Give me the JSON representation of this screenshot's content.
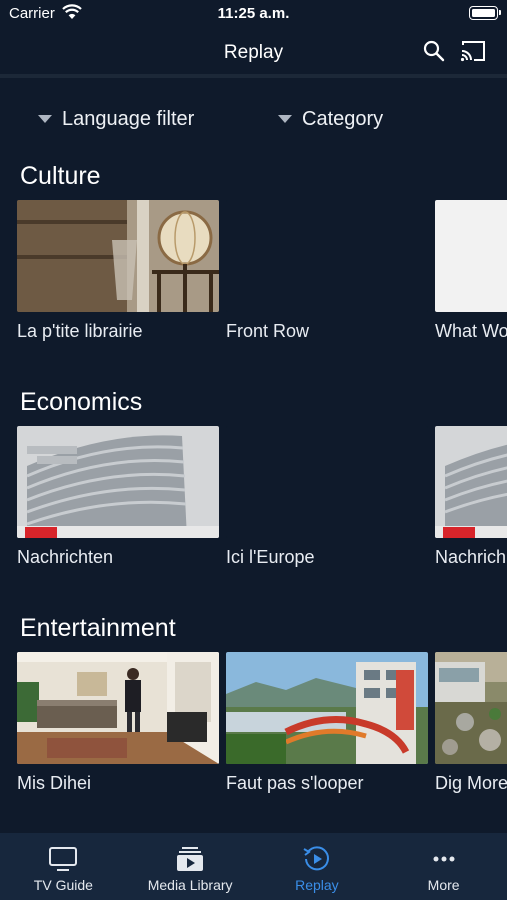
{
  "status_bar": {
    "carrier": "Carrier",
    "time": "11:25 a.m."
  },
  "nav": {
    "title": "Replay",
    "search_icon": "search-icon",
    "cast_icon": "cast-icon"
  },
  "filters": {
    "language": "Language filter",
    "category": "Category"
  },
  "sections": [
    {
      "title": "Culture",
      "items": [
        {
          "title": "La p'tite librairie"
        },
        {
          "title": "Front Row"
        },
        {
          "title": "What Wo"
        }
      ]
    },
    {
      "title": "Economics",
      "items": [
        {
          "title": "Nachrichten"
        },
        {
          "title": "Ici l'Europe"
        },
        {
          "title": "Nachrich"
        }
      ]
    },
    {
      "title": "Entertainment",
      "items": [
        {
          "title": "Mis Dihei"
        },
        {
          "title": "Faut pas s'looper"
        },
        {
          "title": "Dig More"
        }
      ]
    }
  ],
  "tabs": [
    {
      "label": "TV Guide",
      "icon": "tv-icon"
    },
    {
      "label": "Media Library",
      "icon": "media-library-icon"
    },
    {
      "label": "Replay",
      "icon": "replay-icon",
      "active": true
    },
    {
      "label": "More",
      "icon": "more-icon"
    }
  ],
  "colors": {
    "background": "#0f1a2b",
    "tab_bar": "#17273d",
    "accent": "#3a8ee8"
  }
}
